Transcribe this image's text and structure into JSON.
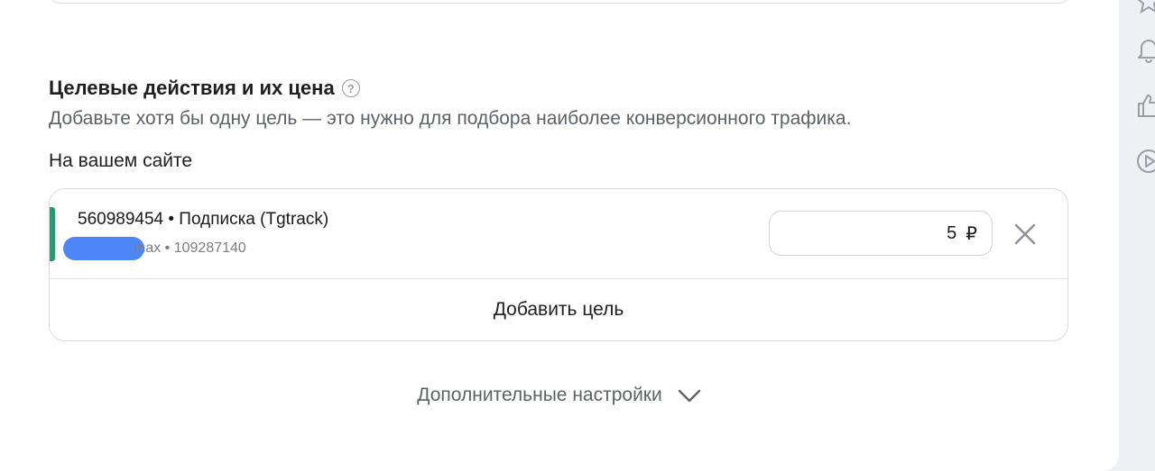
{
  "section": {
    "title": "Целевые действия и их цена",
    "help_icon": "?",
    "description": "Добавьте хотя бы одну цель — это нужно для подбора наиболее конверсионного трафика.",
    "site_label": "На вашем сайте"
  },
  "goal": {
    "name": "560989454 • Подписка (Tgtrack)",
    "meta_suffix": "max • 109287140",
    "price_value": "5",
    "currency": "₽",
    "accent_color": "#22a06b"
  },
  "add_goal_label": "Добавить цель",
  "more_settings_label": "Дополнительные настройки",
  "right_rail_icons": [
    "star-icon",
    "bell-icon",
    "thumbs-up-icon",
    "play-icon"
  ]
}
